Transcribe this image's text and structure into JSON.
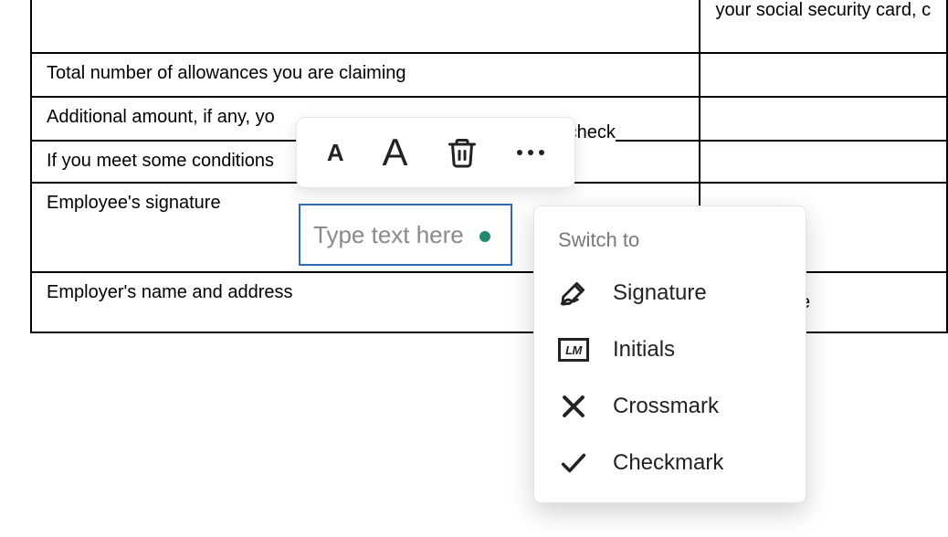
{
  "top_right_partial": "your social security card, c",
  "rows": {
    "allowances": "Total number of allowances you are claiming",
    "additional": "Additional amount, if any, yo",
    "additional_fragment": "ay check",
    "conditions": "If you meet some conditions",
    "signature": "Employee's signature",
    "employer": "Employer's name and address"
  },
  "text_input": {
    "placeholder": "Type text here"
  },
  "menu": {
    "header": "Switch to",
    "signature": "Signature",
    "initials": "Initials",
    "initials_tag": "LM",
    "crossmark": "Crossmark",
    "checkmark": "Checkmark"
  },
  "stray_e": "e"
}
